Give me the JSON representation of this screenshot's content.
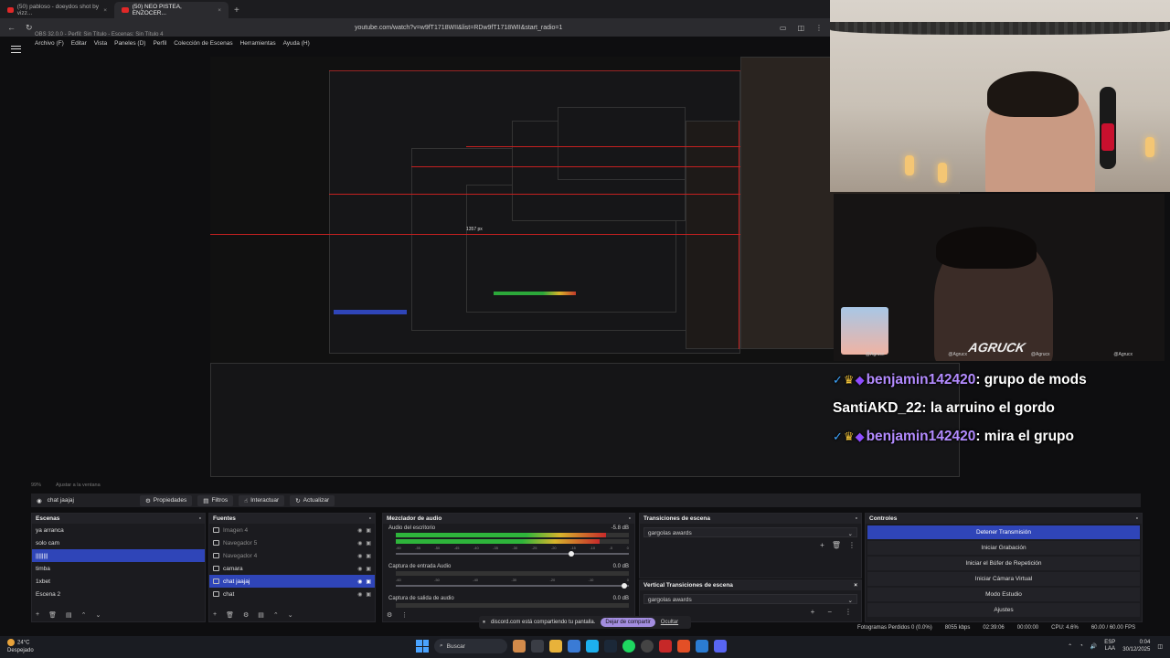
{
  "browser": {
    "tabs": [
      {
        "label": "(50) pabloso - doeydos shot by vizz..."
      },
      {
        "label": "(50) NEO PISTEA, ENZOCER..."
      }
    ],
    "url": "youtube.com/watch?v=w9fT1718WII&list=RDw9fT1718WII&start_radio=1"
  },
  "obs": {
    "title": "OBS 32.0.0 - Perfil: Sin Título - Escenas: Sin Título 4",
    "menu": [
      "Archivo (F)",
      "Editar",
      "Vista",
      "Paneles (D)",
      "Perfil",
      "Colección de Escenas",
      "Herramientas",
      "Ayuda (H)"
    ],
    "status_left": "99%",
    "status_fit": "Ajustar a la ventana",
    "toolbar": {
      "source_name": "chat jaajaj",
      "properties": "Propiedades",
      "filters": "Filtros",
      "interact": "Interactuar",
      "refresh": "Actualizar"
    },
    "scenes": {
      "title": "Escenas",
      "items": [
        "ya arranca",
        "solo cam",
        "||||||||",
        "timba",
        "1xbet",
        "Escena 2"
      ]
    },
    "sources": {
      "title": "Fuentes",
      "items": [
        "Imagen 4",
        "Navegador 5",
        "Navegador 4",
        "camara",
        "chat jaajaj",
        "chat"
      ]
    },
    "mixer": {
      "title": "Mezclador de audio",
      "channels": [
        {
          "name": "Audio del escritorio",
          "db": "-5.8 dB",
          "level": 0.9
        },
        {
          "name": "Captura de entrada Audio",
          "db": "0.0 dB",
          "level": 0.0
        },
        {
          "name": "Captura de salida de audio",
          "db": "0.0 dB",
          "level": 0.0
        }
      ],
      "scale": [
        "-60",
        "-55",
        "-50",
        "-45",
        "-40",
        "-35",
        "-30",
        "-25",
        "-20",
        "-15",
        "-10",
        "-5",
        "0"
      ]
    },
    "transitions": {
      "title": "Transiciones de escena",
      "selected": "gargolas awards",
      "vertical_title": "Vertical Transiciones de escena",
      "vertical_selected": "gargolas awards"
    },
    "controls": {
      "title": "Controles",
      "buttons": [
        "Detener Transmisión",
        "Iniciar Grabación",
        "Iniciar el Búfer de Repetición",
        "Iniciar Cámara Virtual",
        "Modo Estudio",
        "Ajustes"
      ]
    },
    "stats": {
      "dropped": "Fotogramas Perdidos 0 (0.0%)",
      "bitrate": "8055 kbps",
      "time": "02:39:06",
      "rec": "00:00:00",
      "cpu": "CPU: 4.6%",
      "fps": "60.00 / 60.00 FPS"
    }
  },
  "share_bar": {
    "text": "discord.com está compartiendo tu pantalla.",
    "stop": "Dejar de compartir",
    "hide": "Ocultar"
  },
  "preview": {
    "measure_label": "1357 px"
  },
  "chat": [
    {
      "user": "benjamin142420",
      "message": "grupo de mods",
      "badges": true
    },
    {
      "user": "SantiAKD_22",
      "message": "la arruino el gordo",
      "badges": false
    },
    {
      "user": "benjamin142420",
      "message": "mira el grupo",
      "badges": true
    }
  ],
  "cam2": {
    "logo": "AGRUCK",
    "handles": [
      "@Agrucx",
      "@Agrucx",
      "@Agrucx",
      "@Agrucx"
    ]
  },
  "taskbar": {
    "weather_temp": "24°C",
    "weather_desc": "Despejado",
    "search": "Buscar",
    "lang1": "ESP",
    "lang2": "LAA",
    "time": "0:04",
    "date": "30/12/2025"
  },
  "colors": {
    "accent": "#2f45b8",
    "red_guides": "#c42020",
    "stop_share": "#a38de0"
  }
}
